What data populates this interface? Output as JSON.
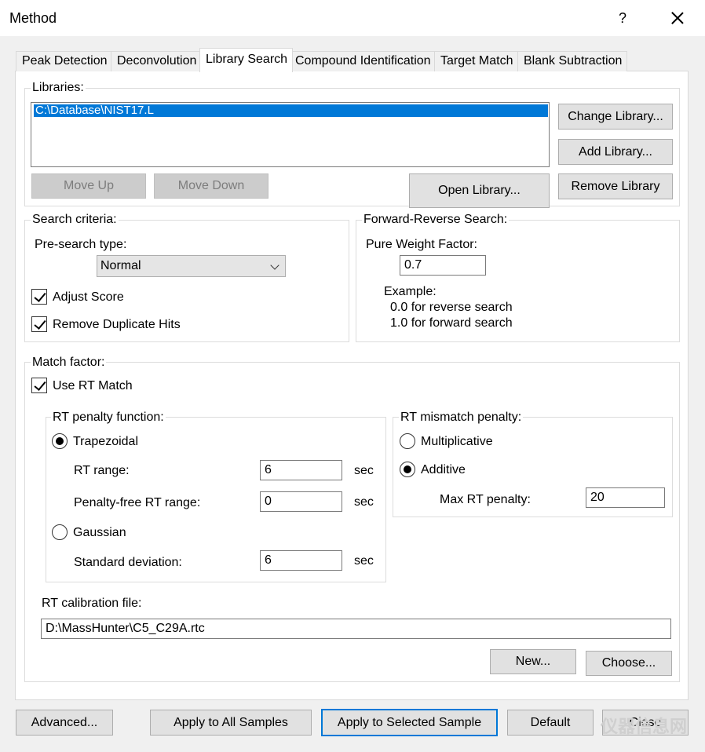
{
  "window": {
    "title": "Method",
    "help": "?"
  },
  "tabs": [
    "Peak Detection",
    "Deconvolution",
    "Library Search",
    "Compound Identification",
    "Target Match",
    "Blank Subtraction"
  ],
  "active_tab": "Library Search",
  "libraries": {
    "label": "Libraries:",
    "items": [
      "C:\\Database\\NIST17.L"
    ],
    "change_library": "Change Library...",
    "add_library": "Add Library...",
    "move_up": "Move Up",
    "move_down": "Move Down",
    "open_library": "Open Library...",
    "remove_library": "Remove Library"
  },
  "search_criteria": {
    "label": "Search criteria:",
    "presearch_label": "Pre-search type:",
    "presearch_value": "Normal",
    "adjust_score": "Adjust Score",
    "adjust_score_checked": true,
    "remove_duplicates": "Remove Duplicate Hits",
    "remove_duplicates_checked": true
  },
  "forward_reverse": {
    "label": "Forward-Reverse Search:",
    "pure_weight_label": "Pure Weight Factor:",
    "pure_weight_value": "0.7",
    "example_label": "Example:",
    "example_line1": "0.0 for reverse search",
    "example_line2": "1.0 for forward search"
  },
  "match_factor": {
    "label": "Match factor:",
    "use_rt_match": "Use RT Match",
    "use_rt_match_checked": true,
    "rt_penalty_function": {
      "label": "RT penalty function:",
      "trapezoidal": "Trapezoidal",
      "rt_range_label": "RT range:",
      "rt_range_value": "6",
      "penalty_free_label": "Penalty-free RT range:",
      "penalty_free_value": "0",
      "gaussian": "Gaussian",
      "std_dev_label": "Standard deviation:",
      "std_dev_value": "6",
      "unit": "sec",
      "selected": "Trapezoidal"
    },
    "rt_mismatch_penalty": {
      "label": "RT mismatch penalty:",
      "multiplicative": "Multiplicative",
      "additive": "Additive",
      "selected": "Additive",
      "max_rt_penalty_label": "Max RT penalty:",
      "max_rt_penalty_value": "20"
    },
    "rt_calibration_label": "RT calibration file:",
    "rt_calibration_value": "D:\\MassHunter\\C5_C29A.rtc",
    "new_button": "New...",
    "choose_button": "Choose..."
  },
  "footer": {
    "advanced": "Advanced...",
    "apply_all": "Apply to All Samples",
    "apply_selected": "Apply to Selected Sample",
    "default": "Default",
    "close": "Close"
  },
  "watermark": "仪器信息网"
}
